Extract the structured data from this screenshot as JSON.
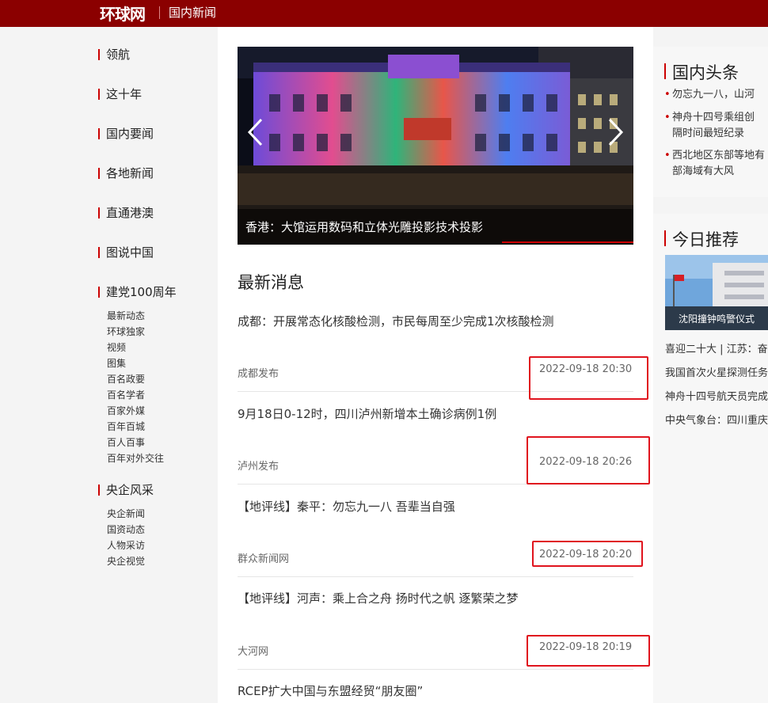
{
  "header": {
    "logo": "环球网",
    "section": "国内新闻"
  },
  "nav": {
    "items": [
      "领航",
      "这十年",
      "国内要闻",
      "各地新闻",
      "直通港澳",
      "图说中国",
      "建党100周年"
    ],
    "party_sub": [
      "最新动态",
      "环球独家",
      "视频",
      "图集",
      "百名政要",
      "百名学者",
      "百家外媒",
      "百年百城",
      "百人百事",
      "百年对外交往"
    ],
    "soe_title": "央企风采",
    "soe_sub": [
      "央企新闻",
      "国资动态",
      "人物采访",
      "央企视觉"
    ]
  },
  "carousel": {
    "caption": "香港：大馆运用数码和立体光雕投影技术投影"
  },
  "latest": {
    "heading": "最新消息",
    "items": [
      {
        "title": "成都：开展常态化核酸检测，市民每周至少完成1次核酸检测",
        "source": "成都发布",
        "time": "2022-09-18 20:30"
      },
      {
        "title": "9月18日0-12时，四川泸州新增本土确诊病例1例",
        "source": "泸州发布",
        "time": "2022-09-18 20:26"
      },
      {
        "title": "【地评线】秦平：勿忘九一八 吾辈当自强",
        "source": "群众新闻网",
        "time": "2022-09-18 20:20"
      },
      {
        "title": "【地评线】河声：乘上合之舟 扬时代之帆 逐繁荣之梦",
        "source": "大河网",
        "time": "2022-09-18 20:19"
      },
      {
        "title": "RCEP扩大中国与东盟经贸“朋友圈”"
      }
    ]
  },
  "headlines": {
    "title": "国内头条",
    "items": [
      {
        "line1": "勿忘九一八，山河"
      },
      {
        "line1": "神舟十四号乘组创",
        "line2": "隔时间最短纪录"
      },
      {
        "line1": "西北地区东部等地有",
        "line2": "部海域有大风"
      }
    ]
  },
  "recommend": {
    "title": "今日推荐",
    "image_caption": "沈阳撞钟鸣警仪式",
    "items": [
      "喜迎二十大 | 江苏：奋",
      "我国首次火星探测任务",
      "神舟十四号航天员完成",
      "中央气象台：四川重庆"
    ]
  },
  "colors": {
    "brand": "#8b0000",
    "accent": "#cc0000",
    "highlight_box": "#e0141e"
  }
}
